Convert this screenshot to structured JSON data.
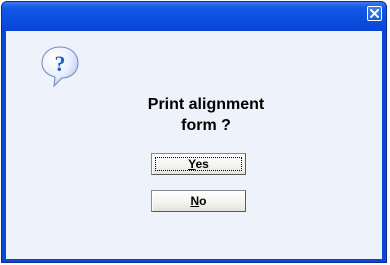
{
  "window": {
    "title": "",
    "close_icon": "close-icon"
  },
  "dialog": {
    "icon": "help-question-icon",
    "message_line1": "Print alignment",
    "message_line2": "form ?"
  },
  "buttons": {
    "yes": {
      "mnemonic": "Y",
      "rest": "es",
      "focused": true
    },
    "no": {
      "mnemonic": "N",
      "rest": "o",
      "focused": false
    }
  },
  "colors": {
    "title_bar": "#0a4fde",
    "frame": "#0a47d8",
    "client_background": "#eef2fb",
    "icon_blue": "#1f5fd0"
  }
}
